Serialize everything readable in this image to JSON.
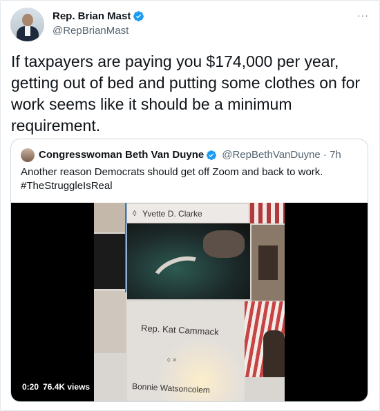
{
  "author": {
    "name": "Rep. Brian Mast",
    "handle": "@RepBrianMast",
    "verified_icon": "verified-badge-icon"
  },
  "more_menu": "···",
  "tweet": {
    "text": "If taxpayers are paying you $174,000 per year, getting out of bed and putting some clothes on for work seems like it should be a minimum requirement."
  },
  "quoted": {
    "name": "Congresswoman Beth Van Duyne",
    "handle": "@RepBethVanDuyne · 7h",
    "text_line1": "Another reason Democrats should get off Zoom and back to work.",
    "text_line2": "#TheStruggleIsReal",
    "video": {
      "label_top": "Yvette D. Clarke",
      "label_middle": "Rep. Kat Cammack",
      "label_bottom": "Bonnie Watsoncolem",
      "duration": "0:20",
      "views": "76.4K views"
    }
  },
  "colors": {
    "verified_blue": "#1d9bf0",
    "secondary_text": "#536471"
  }
}
